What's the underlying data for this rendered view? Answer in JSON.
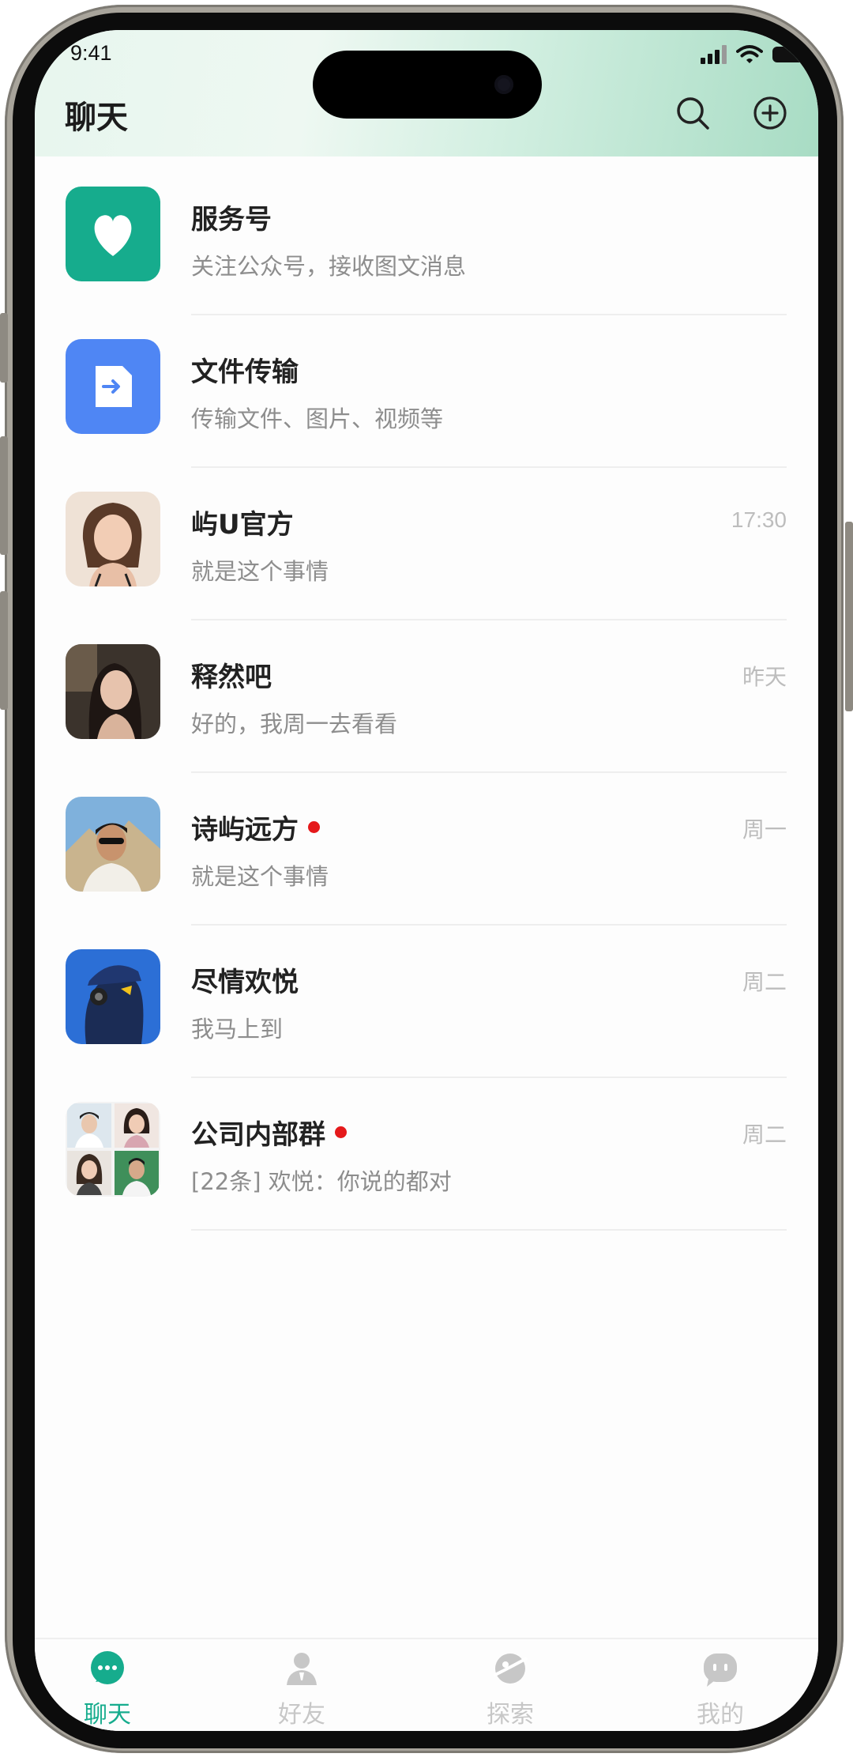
{
  "status_bar": {
    "time": "9:41"
  },
  "header": {
    "title": "聊天"
  },
  "chats": [
    {
      "name": "服务号",
      "preview": "关注公众号，接收图文消息",
      "time": "",
      "unread": false,
      "avatar": "heart-icon"
    },
    {
      "name": "文件传输",
      "preview": "传输文件、图片、视频等",
      "time": "",
      "unread": false,
      "avatar": "file-transfer-icon"
    },
    {
      "name": "屿U官方",
      "preview": "就是这个事情",
      "time": "17:30",
      "unread": false,
      "avatar": "user-photo"
    },
    {
      "name": "释然吧",
      "preview": "好的，我周一去看看",
      "time": "昨天",
      "unread": false,
      "avatar": "user-photo"
    },
    {
      "name": "诗屿远方",
      "preview": "就是这个事情",
      "time": "周一",
      "unread": true,
      "avatar": "user-photo"
    },
    {
      "name": "尽情欢悦",
      "preview": "我马上到",
      "time": "周二",
      "unread": false,
      "avatar": "user-photo"
    },
    {
      "name": "公司内部群",
      "preview": "[22条] 欢悦：你说的都对",
      "time": "周二",
      "unread": true,
      "avatar": "group-photo-grid"
    }
  ],
  "tabbar": {
    "tabs": [
      {
        "label": "聊天",
        "icon": "chat-bubble-icon",
        "active": true
      },
      {
        "label": "好友",
        "icon": "contacts-icon",
        "active": false
      },
      {
        "label": "探索",
        "icon": "planet-icon",
        "active": false
      },
      {
        "label": "我的",
        "icon": "profile-face-icon",
        "active": false
      }
    ]
  },
  "colors": {
    "accent": "#16ac8d",
    "file_blue": "#4f86f4",
    "unread": "#e5191b",
    "inactive": "#c7c7c7"
  }
}
